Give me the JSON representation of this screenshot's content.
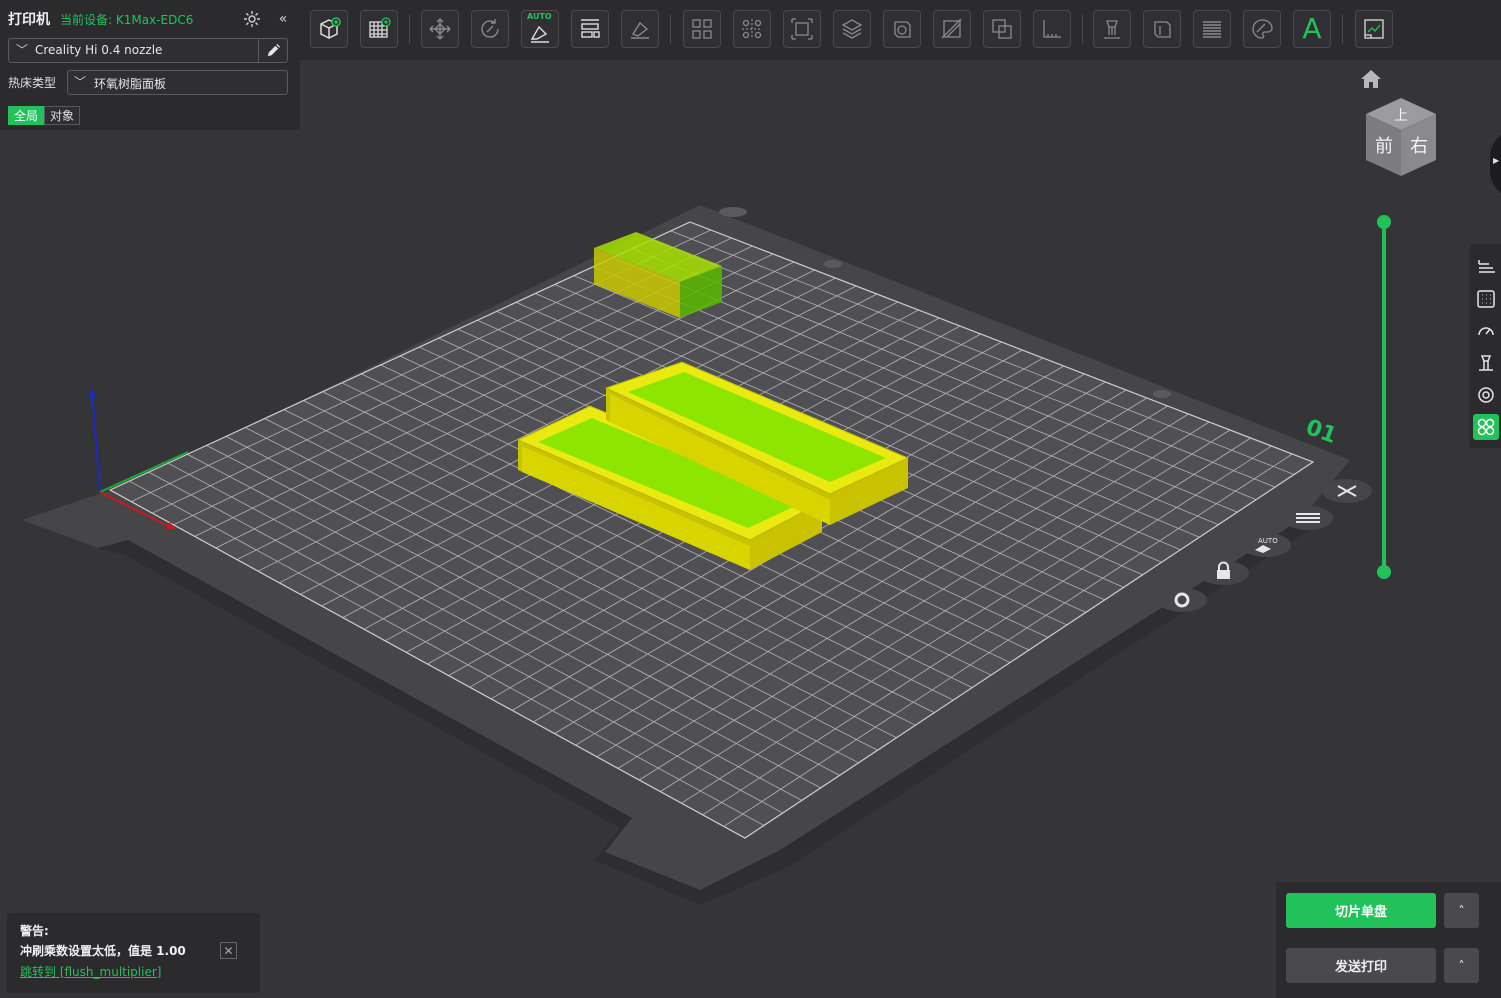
{
  "printer": {
    "title": "打印机",
    "device_label": "当前设备: K1Max-EDC6",
    "nozzle": "Creality Hi 0.4 nozzle",
    "bed_type_label": "热床类型",
    "bed_type_value": "环氧树脂面板",
    "tabs": [
      "全局",
      "对象"
    ]
  },
  "toolbar": {
    "items": [
      "add-object-icon",
      "plate-grid-icon",
      "move-icon",
      "rotate-icon",
      "auto-orient-icon",
      "arrange-icon",
      "lay-on-face-icon",
      "split-objects-icon",
      "split-parts-icon",
      "scale-icon",
      "layer-view-icon",
      "hollow-icon",
      "cut-icon",
      "boolean-icon",
      "measure-icon",
      "support-paint-icon",
      "seam-paint-icon",
      "variable-layer-icon",
      "color-paint-icon",
      "text-icon",
      "assemble-icon"
    ],
    "auto_badge": "AUTO",
    "text_tool_glyph": "A"
  },
  "viewport": {
    "view_cube_faces": [
      "上",
      "前",
      "右"
    ],
    "plate_number": "01",
    "plate_buttons": [
      "close-plate-icon",
      "plate-settings-list-icon",
      "auto-arrange-plate-icon",
      "lock-plate-icon",
      "plate-gear-icon"
    ],
    "auto_button_text": "AUTO"
  },
  "right_tools": [
    "layers-icon",
    "plate-grid-icon",
    "speed-icon",
    "support-icon",
    "seam-icon",
    "objects-icon"
  ],
  "warning": {
    "title": "警告:",
    "message": "冲刷乘数设置太低，值是 1.00",
    "link": "跳转到 [flush_multiplier]"
  },
  "actions": {
    "slice_label": "切片单盘",
    "print_label": "发送打印",
    "expand_glyph": "˄"
  },
  "colors": {
    "accent": "#22c25a",
    "model_yellow": "#e8e800",
    "model_green": "#7be800",
    "background": "#353538"
  }
}
